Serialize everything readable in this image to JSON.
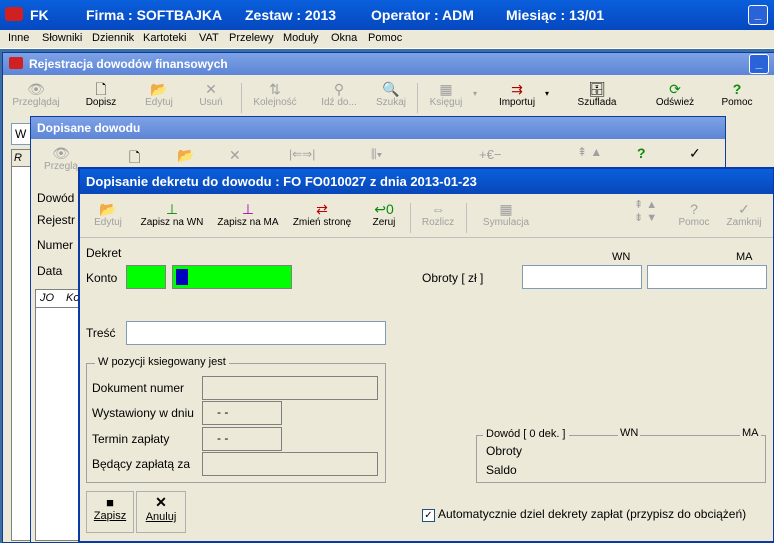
{
  "main_title": {
    "app": "FK",
    "firma": "Firma : SOFTBAJKA",
    "zestaw": "Zestaw : 2013",
    "operator": "Operator : ADM",
    "miesiac": "Miesiąc : 13/01"
  },
  "menu": [
    "Inne",
    "Słowniki",
    "Dziennik",
    "Kartoteki",
    "VAT",
    "Przelewy",
    "Moduły",
    "Okna",
    "Pomoc"
  ],
  "reg_window": {
    "title": "Rejestracja dowodów finansowych",
    "toolbar": [
      {
        "label": "Przeglądaj",
        "icon": "👁",
        "enabled": false
      },
      {
        "label": "Dopisz",
        "icon": "🗋",
        "enabled": true
      },
      {
        "label": "Edytuj",
        "icon": "📂",
        "enabled": false
      },
      {
        "label": "Usuń",
        "icon": "✕",
        "enabled": false
      },
      {
        "label": "Kolejność",
        "icon": "⇅",
        "enabled": false
      },
      {
        "label": "Idź do...",
        "icon": "⚲",
        "enabled": false
      },
      {
        "label": "Szukaj",
        "icon": "🔍",
        "enabled": false
      },
      {
        "label": "Księguj",
        "icon": "▦",
        "enabled": false
      },
      {
        "label": "Importuj",
        "icon": "⇉",
        "enabled": true
      },
      {
        "label": "Szuflada",
        "icon": "🗄",
        "enabled": true
      },
      {
        "label": "Odśwież",
        "icon": "⟳",
        "enabled": true
      },
      {
        "label": "Pomoc",
        "icon": "?",
        "enabled": true
      }
    ],
    "left_input": "W",
    "left_col": "R"
  },
  "dopisane_window": {
    "title": "Dopisane dowodu",
    "toolbar_first": "Przeglą",
    "labels": [
      "Dowód",
      "Rejestr",
      "Numer",
      "Data"
    ],
    "grid_cols": [
      "JO",
      "Ko"
    ]
  },
  "dekret_dialog": {
    "title": "Dopisanie dekretu do dowodu : FO FO010027  z dnia  2013-01-23",
    "toolbar": [
      {
        "label": "Edytuj",
        "enabled": false
      },
      {
        "label": "Zapisz na WN",
        "enabled": true
      },
      {
        "label": "Zapisz na MA",
        "enabled": true
      },
      {
        "label": "Zmień stronę",
        "enabled": true
      },
      {
        "label": "Zeruj",
        "enabled": true
      },
      {
        "label": "Rozlicz",
        "enabled": false
      },
      {
        "label": "Symulacja",
        "enabled": false
      },
      {
        "label": "Pomoc",
        "enabled": false
      },
      {
        "label": "Zamknij",
        "enabled": false
      }
    ],
    "section_label": "Dekret",
    "konto_label": "Konto",
    "obroty_label": "Obroty [ zł ]",
    "wn_header": "WN",
    "ma_header": "MA",
    "tresc_label": "Treść",
    "pozycja_group": "W pozycji ksiegowany jest",
    "pozycja_fields": [
      {
        "label": "Dokument numer",
        "value": ""
      },
      {
        "label": "Wystawiony w dniu",
        "value": "- -"
      },
      {
        "label": "Termin zapłaty",
        "value": "- -"
      },
      {
        "label": "Będący zapłatą za",
        "value": ""
      }
    ],
    "dowod_group": "Dowód [      0 dek. ]",
    "dowod_wn": "WN",
    "dowod_ma": "MA",
    "obroty": "Obroty",
    "saldo": "Saldo",
    "zapisz": "Zapisz",
    "anuluj": "Anuluj",
    "auto_checkbox": "Automatycznie dziel dekrety zapłat (przypisz do obciążeń)",
    "auto_checked": true
  },
  "colors": {
    "konto_bg": "#00ff00",
    "title_active": "#0a5fdc"
  }
}
